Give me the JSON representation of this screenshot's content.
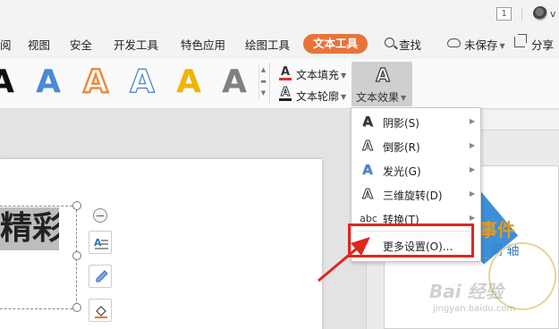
{
  "titlebar": {
    "badge": "1",
    "user_initial": "v"
  },
  "menu": {
    "items": [
      "阅",
      "视图",
      "安全",
      "开发工具",
      "特色应用",
      "绘图工具"
    ],
    "active": "文本工具",
    "search": "查找",
    "unsaved": "未保存",
    "share": "分享"
  },
  "ribbon": {
    "styles": [
      {
        "glyph": "A",
        "color": "#111111",
        "kind": "solid"
      },
      {
        "glyph": "A",
        "color": "#3a7fd0",
        "kind": "gradient"
      },
      {
        "glyph": "A",
        "color": "#ef8a3b",
        "kind": "outline"
      },
      {
        "glyph": "A",
        "color": "#3a7fd0",
        "kind": "thin-outline"
      },
      {
        "glyph": "A",
        "color": "#f0b400",
        "kind": "solid"
      },
      {
        "glyph": "A",
        "color": "#777777",
        "kind": "gradient"
      }
    ],
    "fill_label": "文本填充",
    "outline_label": "文本轮廓",
    "effect_label": "文本效果",
    "effect_icon": "A"
  },
  "document": {
    "text": "精彩"
  },
  "dropdown": {
    "items": [
      {
        "icon": "shadow-A-icon",
        "glyph": "A",
        "label": "阴影(S)",
        "submenu": true
      },
      {
        "icon": "reflection-A-icon",
        "glyph": "A",
        "label": "倒影(R)",
        "submenu": true
      },
      {
        "icon": "glow-A-icon",
        "glyph": "A",
        "label": "发光(G)",
        "submenu": true
      },
      {
        "icon": "3d-rotate-A-icon",
        "glyph": "A",
        "label": "三维旋转(D)",
        "submenu": true
      },
      {
        "icon": "transform-abc-icon",
        "glyph": "abc",
        "label": "转换(T)",
        "submenu": true
      },
      {
        "icon": "",
        "glyph": "",
        "label": "更多设置(O)...",
        "submenu": false
      }
    ]
  },
  "slide_thumb": {
    "title": "事件",
    "subtitle": "间 轴",
    "watermark": "Bai 经验",
    "watermark_url": "jingyan.baidu.com"
  },
  "colors": {
    "accent": "#e8743b",
    "highlight": "#e1261c"
  }
}
